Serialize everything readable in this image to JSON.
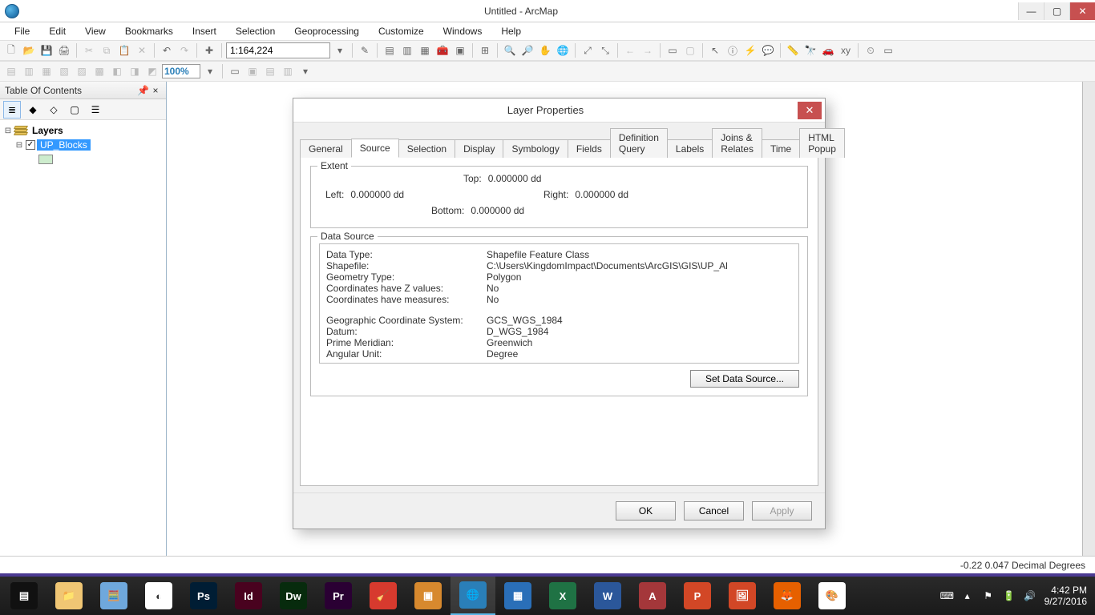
{
  "window": {
    "title": "Untitled - ArcMap",
    "controls": {
      "min": "—",
      "max": "▢",
      "close": "✕"
    }
  },
  "menu": [
    "File",
    "Edit",
    "View",
    "Bookmarks",
    "Insert",
    "Selection",
    "Geoprocessing",
    "Customize",
    "Windows",
    "Help"
  ],
  "toolbar": {
    "scale_value": "1:164,224",
    "zoom_pct": "100%"
  },
  "toc": {
    "title": "Table Of Contents",
    "pin": "📌",
    "close": "×",
    "root": "Layers",
    "layer": "UP_Blocks"
  },
  "dialog": {
    "title": "Layer Properties",
    "tabs": [
      "General",
      "Source",
      "Selection",
      "Display",
      "Symbology",
      "Fields",
      "Definition Query",
      "Labels",
      "Joins & Relates",
      "Time",
      "HTML Popup"
    ],
    "active_tab": "Source",
    "extent": {
      "legend": "Extent",
      "top_label": "Top:",
      "top_value": "0.000000 dd",
      "left_label": "Left:",
      "left_value": "0.000000 dd",
      "right_label": "Right:",
      "right_value": "0.000000 dd",
      "bottom_label": "Bottom:",
      "bottom_value": "0.000000 dd"
    },
    "data_source": {
      "legend": "Data Source",
      "rows": {
        "data_type_label": "Data Type:",
        "data_type_value": "Shapefile Feature Class",
        "shapefile_label": "Shapefile:",
        "shapefile_value": "C:\\Users\\KingdomImpact\\Documents\\ArcGIS\\GIS\\UP_Al",
        "geom_label": "Geometry Type:",
        "geom_value": "Polygon",
        "z_label": "Coordinates have Z values:",
        "z_value": "No",
        "m_label": "Coordinates have measures:",
        "m_value": "No",
        "gcs_label": "Geographic Coordinate System:",
        "gcs_value": "GCS_WGS_1984",
        "datum_label": "Datum:",
        "datum_value": "D_WGS_1984",
        "pm_label": "Prime Meridian:",
        "pm_value": "Greenwich",
        "au_label": "Angular Unit:",
        "au_value": "Degree"
      },
      "set_btn": "Set Data Source..."
    },
    "buttons": {
      "ok": "OK",
      "cancel": "Cancel",
      "apply": "Apply"
    }
  },
  "status": "-0.22  0.047 Decimal Degrees",
  "taskbar": {
    "items": [
      {
        "name": "start",
        "bg": "#111",
        "txt": "▤"
      },
      {
        "name": "explorer",
        "bg": "#f0c674",
        "txt": "📁"
      },
      {
        "name": "calc",
        "bg": "#6fa8dc",
        "txt": "🧮"
      },
      {
        "name": "chrome",
        "bg": "#fff",
        "txt": "◐"
      },
      {
        "name": "photoshop",
        "bg": "#001d34",
        "txt": "Ps"
      },
      {
        "name": "indesign",
        "bg": "#49021f",
        "txt": "Id"
      },
      {
        "name": "dreamweaver",
        "bg": "#072b0d",
        "txt": "Dw"
      },
      {
        "name": "premiere",
        "bg": "#2a0033",
        "txt": "Pr"
      },
      {
        "name": "ccleaner",
        "bg": "#d73a2e",
        "txt": "🧹"
      },
      {
        "name": "app2",
        "bg": "#d7892e",
        "txt": "▣"
      },
      {
        "name": "arcmap-active",
        "bg": "#2a7fb8",
        "txt": "🌐"
      },
      {
        "name": "app3",
        "bg": "#2a6fb8",
        "txt": "▦"
      },
      {
        "name": "excel",
        "bg": "#1f7244",
        "txt": "X"
      },
      {
        "name": "word",
        "bg": "#2b579a",
        "txt": "W"
      },
      {
        "name": "access",
        "bg": "#a4373a",
        "txt": "A"
      },
      {
        "name": "powerpoint",
        "bg": "#d24726",
        "txt": "P"
      },
      {
        "name": "picman",
        "bg": "#d24726",
        "txt": "🖼"
      },
      {
        "name": "firefox",
        "bg": "#e66000",
        "txt": "🦊"
      },
      {
        "name": "paint",
        "bg": "#fff",
        "txt": "🎨"
      }
    ],
    "tray": {
      "keyboard": "⌨",
      "up": "▴",
      "flag": "⚑",
      "battery": "🔋",
      "sound": "🔊",
      "time": "4:42 PM",
      "date": "9/27/2016"
    }
  }
}
